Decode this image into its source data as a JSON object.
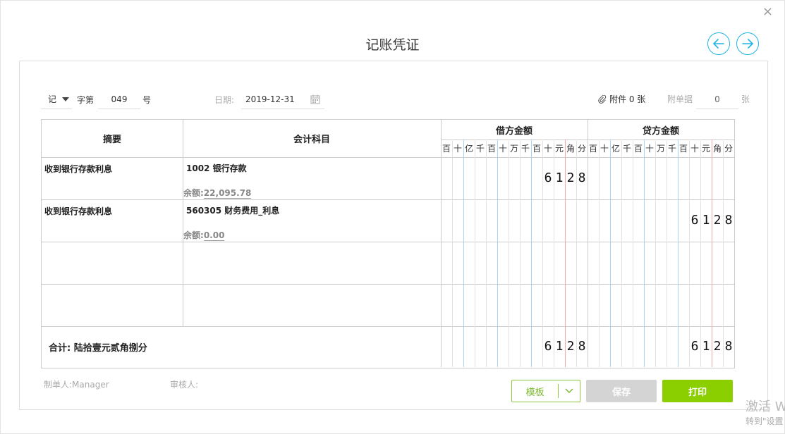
{
  "dialog": {
    "title": "记账凭证",
    "close_glyph": "×"
  },
  "voucher": {
    "type": "记",
    "zi_label": "字第",
    "number": "049",
    "hao_label": "号",
    "date_label": "日期:",
    "date": "2019-12-31",
    "attachment_label": "附件 0 张",
    "bills_label": "附单据",
    "bills_count": "0",
    "bills_unit": "张"
  },
  "table": {
    "headers": {
      "summary": "摘要",
      "subject": "会计科目",
      "debit": "借方金额",
      "credit": "贷方金额"
    },
    "digit_headers": [
      "百",
      "十",
      "亿",
      "千",
      "百",
      "十",
      "万",
      "千",
      "百",
      "十",
      "元",
      "角",
      "分"
    ],
    "rows": [
      {
        "summary": "收到银行存款利息",
        "subject": "1002 银行存款",
        "balance_label": "余额:",
        "balance": "22,095.78",
        "debit_digits": [
          "6",
          "1",
          "2",
          "8"
        ],
        "credit_digits": []
      },
      {
        "summary": "收到银行存款利息",
        "subject": "560305 财务费用_利息",
        "balance_label": "余额:",
        "balance": "0.00",
        "debit_digits": [],
        "credit_digits": [
          "6",
          "1",
          "2",
          "8"
        ]
      },
      {
        "summary": "",
        "subject": "",
        "balance_label": "",
        "balance": "",
        "debit_digits": [],
        "credit_digits": []
      },
      {
        "summary": "",
        "subject": "",
        "balance_label": "",
        "balance": "",
        "debit_digits": [],
        "credit_digits": []
      }
    ],
    "total": {
      "label": "合计:  陆拾壹元贰角捌分",
      "debit_digits": [
        "6",
        "1",
        "2",
        "8"
      ],
      "credit_digits": [
        "6",
        "1",
        "2",
        "8"
      ]
    }
  },
  "footer": {
    "maker_label": "制单人:",
    "maker": "Manager",
    "reviewer_label": "审核人:",
    "template_button": "模板",
    "save_button": "保存",
    "print_button": "打印"
  },
  "watermark": {
    "line1": "激活 W",
    "line2": "转到\"设置"
  },
  "colors": {
    "accent_blue": "#1fb4e5",
    "accent_green": "#8ccf00",
    "template_green": "#8cc63f",
    "disabled_gray": "#d4d4d4",
    "grid_blue": "#a9d3f5",
    "grid_red": "#f1a9a9"
  }
}
